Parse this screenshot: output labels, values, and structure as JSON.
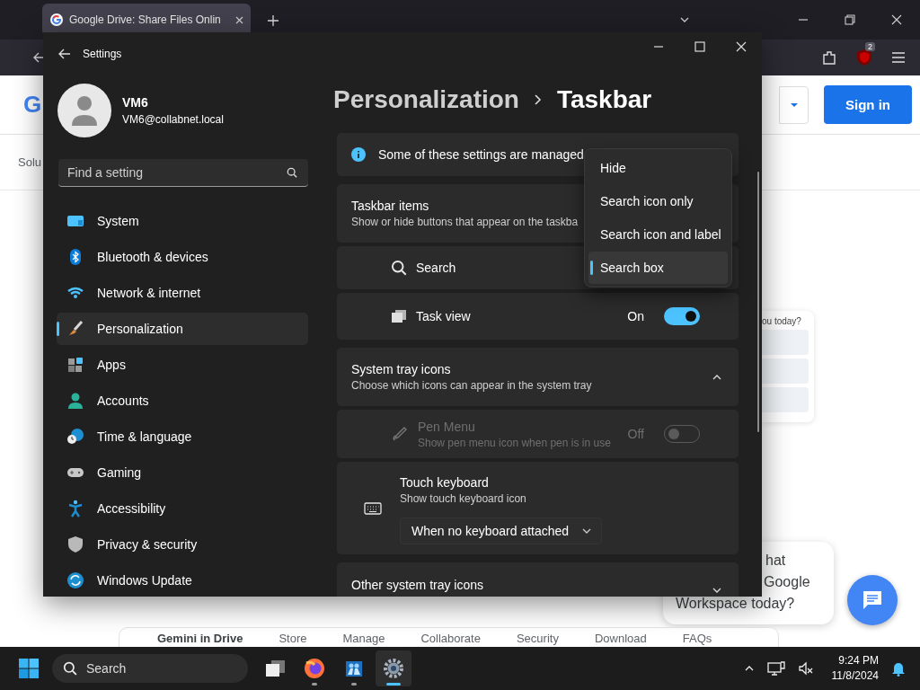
{
  "browser": {
    "tabs": [
      {
        "title": "Google Drive: Share Files Onlin",
        "selected": true
      }
    ],
    "extension_badge": "2"
  },
  "webpage": {
    "logo": "G",
    "sign_in": "Sign in",
    "subnav_text": "Solu",
    "card_text": "ou today?",
    "chat_bubble": [
      "hat",
      "Google",
      "Workspace today?"
    ],
    "footer_nav": [
      {
        "label": "Gemini in Drive",
        "kind": "title"
      },
      {
        "label": "Store",
        "kind": "link"
      },
      {
        "label": "Manage",
        "kind": "link"
      },
      {
        "label": "Collaborate",
        "kind": "link"
      },
      {
        "label": "Security",
        "kind": "link"
      },
      {
        "label": "Download",
        "kind": "link"
      },
      {
        "label": "FAQs",
        "kind": "link"
      }
    ]
  },
  "settings": {
    "title": "Settings",
    "user": {
      "name": "VM6",
      "email": "VM6@collabnet.local"
    },
    "search_placeholder": "Find a setting",
    "nav": [
      {
        "label": "System",
        "selected": false
      },
      {
        "label": "Bluetooth & devices",
        "selected": false
      },
      {
        "label": "Network & internet",
        "selected": false
      },
      {
        "label": "Personalization",
        "selected": true
      },
      {
        "label": "Apps",
        "selected": false
      },
      {
        "label": "Accounts",
        "selected": false
      },
      {
        "label": "Time & language",
        "selected": false
      },
      {
        "label": "Gaming",
        "selected": false
      },
      {
        "label": "Accessibility",
        "selected": false
      },
      {
        "label": "Privacy & security",
        "selected": false
      },
      {
        "label": "Windows Update",
        "selected": false
      }
    ],
    "breadcrumb": {
      "parent": "Personalization",
      "current": "Taskbar"
    },
    "notice": "Some of these settings are managed",
    "sections": [
      {
        "kind": "header",
        "title": "Taskbar items",
        "subtitle": "Show or hide buttons that appear on the taskba"
      },
      {
        "kind": "select",
        "label": "Search"
      },
      {
        "kind": "toggle",
        "label": "Task view",
        "state_text": "On",
        "on": true,
        "disabled": false
      },
      {
        "kind": "header",
        "title": "System tray icons",
        "subtitle": "Choose which icons can appear in the system tray",
        "expanded": true
      },
      {
        "kind": "toggle",
        "label": "Pen Menu",
        "subtitle": "Show pen menu icon when pen is in use",
        "state_text": "Off",
        "on": false,
        "disabled": true
      },
      {
        "kind": "dropdown",
        "label": "Touch keyboard",
        "subtitle": "Show touch keyboard icon",
        "value": "When no keyboard attached"
      },
      {
        "kind": "header",
        "title": "Other system tray icons",
        "expanded": false
      }
    ],
    "menu": {
      "options": [
        {
          "label": "Hide",
          "selected": false
        },
        {
          "label": "Search icon only",
          "selected": false
        },
        {
          "label": "Search icon and label",
          "selected": false
        },
        {
          "label": "Search box",
          "selected": true
        }
      ]
    }
  },
  "taskbar": {
    "search_placeholder": "Search",
    "apps": [
      {
        "kind": "taskview",
        "running": false,
        "selected": false
      },
      {
        "kind": "firefox",
        "running": true,
        "selected": false
      },
      {
        "kind": "people",
        "running": true,
        "selected": false
      },
      {
        "kind": "settings",
        "running": true,
        "selected": true
      }
    ],
    "time": "9:24 PM",
    "date": "11/8/2024"
  }
}
